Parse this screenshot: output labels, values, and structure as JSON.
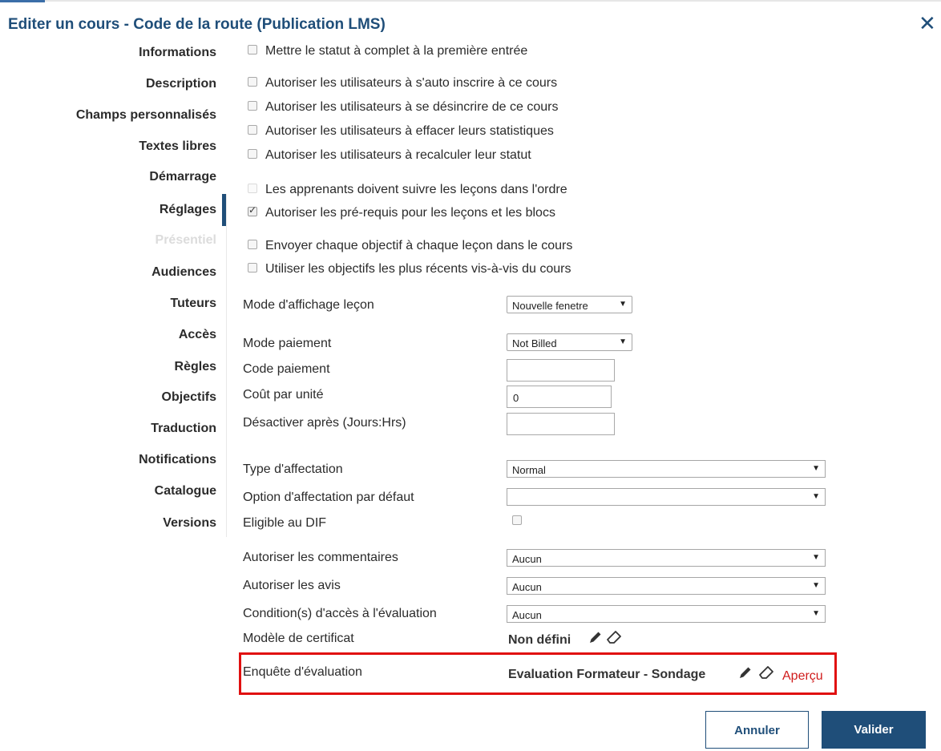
{
  "dialog": {
    "title": "Editer un cours - Code de la route (Publication LMS)"
  },
  "nav": {
    "items": [
      {
        "label": "Informations"
      },
      {
        "label": "Description"
      },
      {
        "label": "Champs personnalisés"
      },
      {
        "label": "Textes libres"
      },
      {
        "label": "Démarrage"
      },
      {
        "label": "Réglages",
        "active": true
      },
      {
        "label": "Présentiel",
        "disabled": true
      },
      {
        "label": "Audiences"
      },
      {
        "label": "Tuteurs"
      },
      {
        "label": "Accès"
      },
      {
        "label": "Règles"
      },
      {
        "label": "Objectifs"
      },
      {
        "label": "Traduction"
      },
      {
        "label": "Notifications"
      },
      {
        "label": "Catalogue"
      },
      {
        "label": "Versions"
      }
    ]
  },
  "settings": {
    "checkboxes": [
      {
        "label": "Mettre le statut à complet à la première entrée",
        "checked": false
      },
      {
        "label": "Autoriser les utilisateurs à s'auto inscrire à ce cours",
        "checked": false
      },
      {
        "label": "Autoriser les utilisateurs à se désincrire de ce cours",
        "checked": false
      },
      {
        "label": "Autoriser les utilisateurs à effacer leurs statistiques",
        "checked": false
      },
      {
        "label": "Autoriser les utilisateurs à recalculer leur statut",
        "checked": false
      },
      {
        "label": "Les apprenants doivent suivre les leçons dans l'ordre",
        "checked": false,
        "disabled": true
      },
      {
        "label": "Autoriser les pré-requis pour les leçons et les blocs",
        "checked": true
      },
      {
        "label": "Envoyer chaque objectif à chaque leçon dans le cours",
        "checked": false
      },
      {
        "label": "Utiliser les objectifs les plus récents vis-à-vis du cours",
        "checked": false
      }
    ],
    "mode_affichage": {
      "label": "Mode d'affichage leçon",
      "value": "Nouvelle fenetre"
    },
    "mode_paiement": {
      "label": "Mode paiement",
      "value": "Not Billed"
    },
    "code_paiement": {
      "label": "Code paiement",
      "value": ""
    },
    "cout_unite": {
      "label": "Coût par unité",
      "value": "0"
    },
    "desactiver": {
      "label": "Désactiver après (Jours:Hrs)",
      "value": ""
    },
    "type_affectation": {
      "label": "Type d'affectation",
      "value": "Normal"
    },
    "option_affectation": {
      "label": "Option d'affectation par défaut",
      "value": ""
    },
    "eligible_dif": {
      "label": "Eligible au DIF",
      "checked": false
    },
    "commentaires": {
      "label": "Autoriser les commentaires",
      "value": "Aucun"
    },
    "avis": {
      "label": "Autoriser les avis",
      "value": "Aucun"
    },
    "conditions": {
      "label": "Condition(s) d'accès à l'évaluation",
      "value": "Aucun"
    },
    "certificat": {
      "label": "Modèle de certificat",
      "value": "Non défini"
    },
    "enquete": {
      "label": "Enquête d'évaluation",
      "value": "Evaluation Formateur - Sondage",
      "preview": "Aperçu"
    }
  },
  "buttons": {
    "cancel": "Annuler",
    "ok": "Valider"
  },
  "colors": {
    "brand": "#1f4e79",
    "highlight": "#e01010",
    "link_red": "#d01c1c"
  }
}
